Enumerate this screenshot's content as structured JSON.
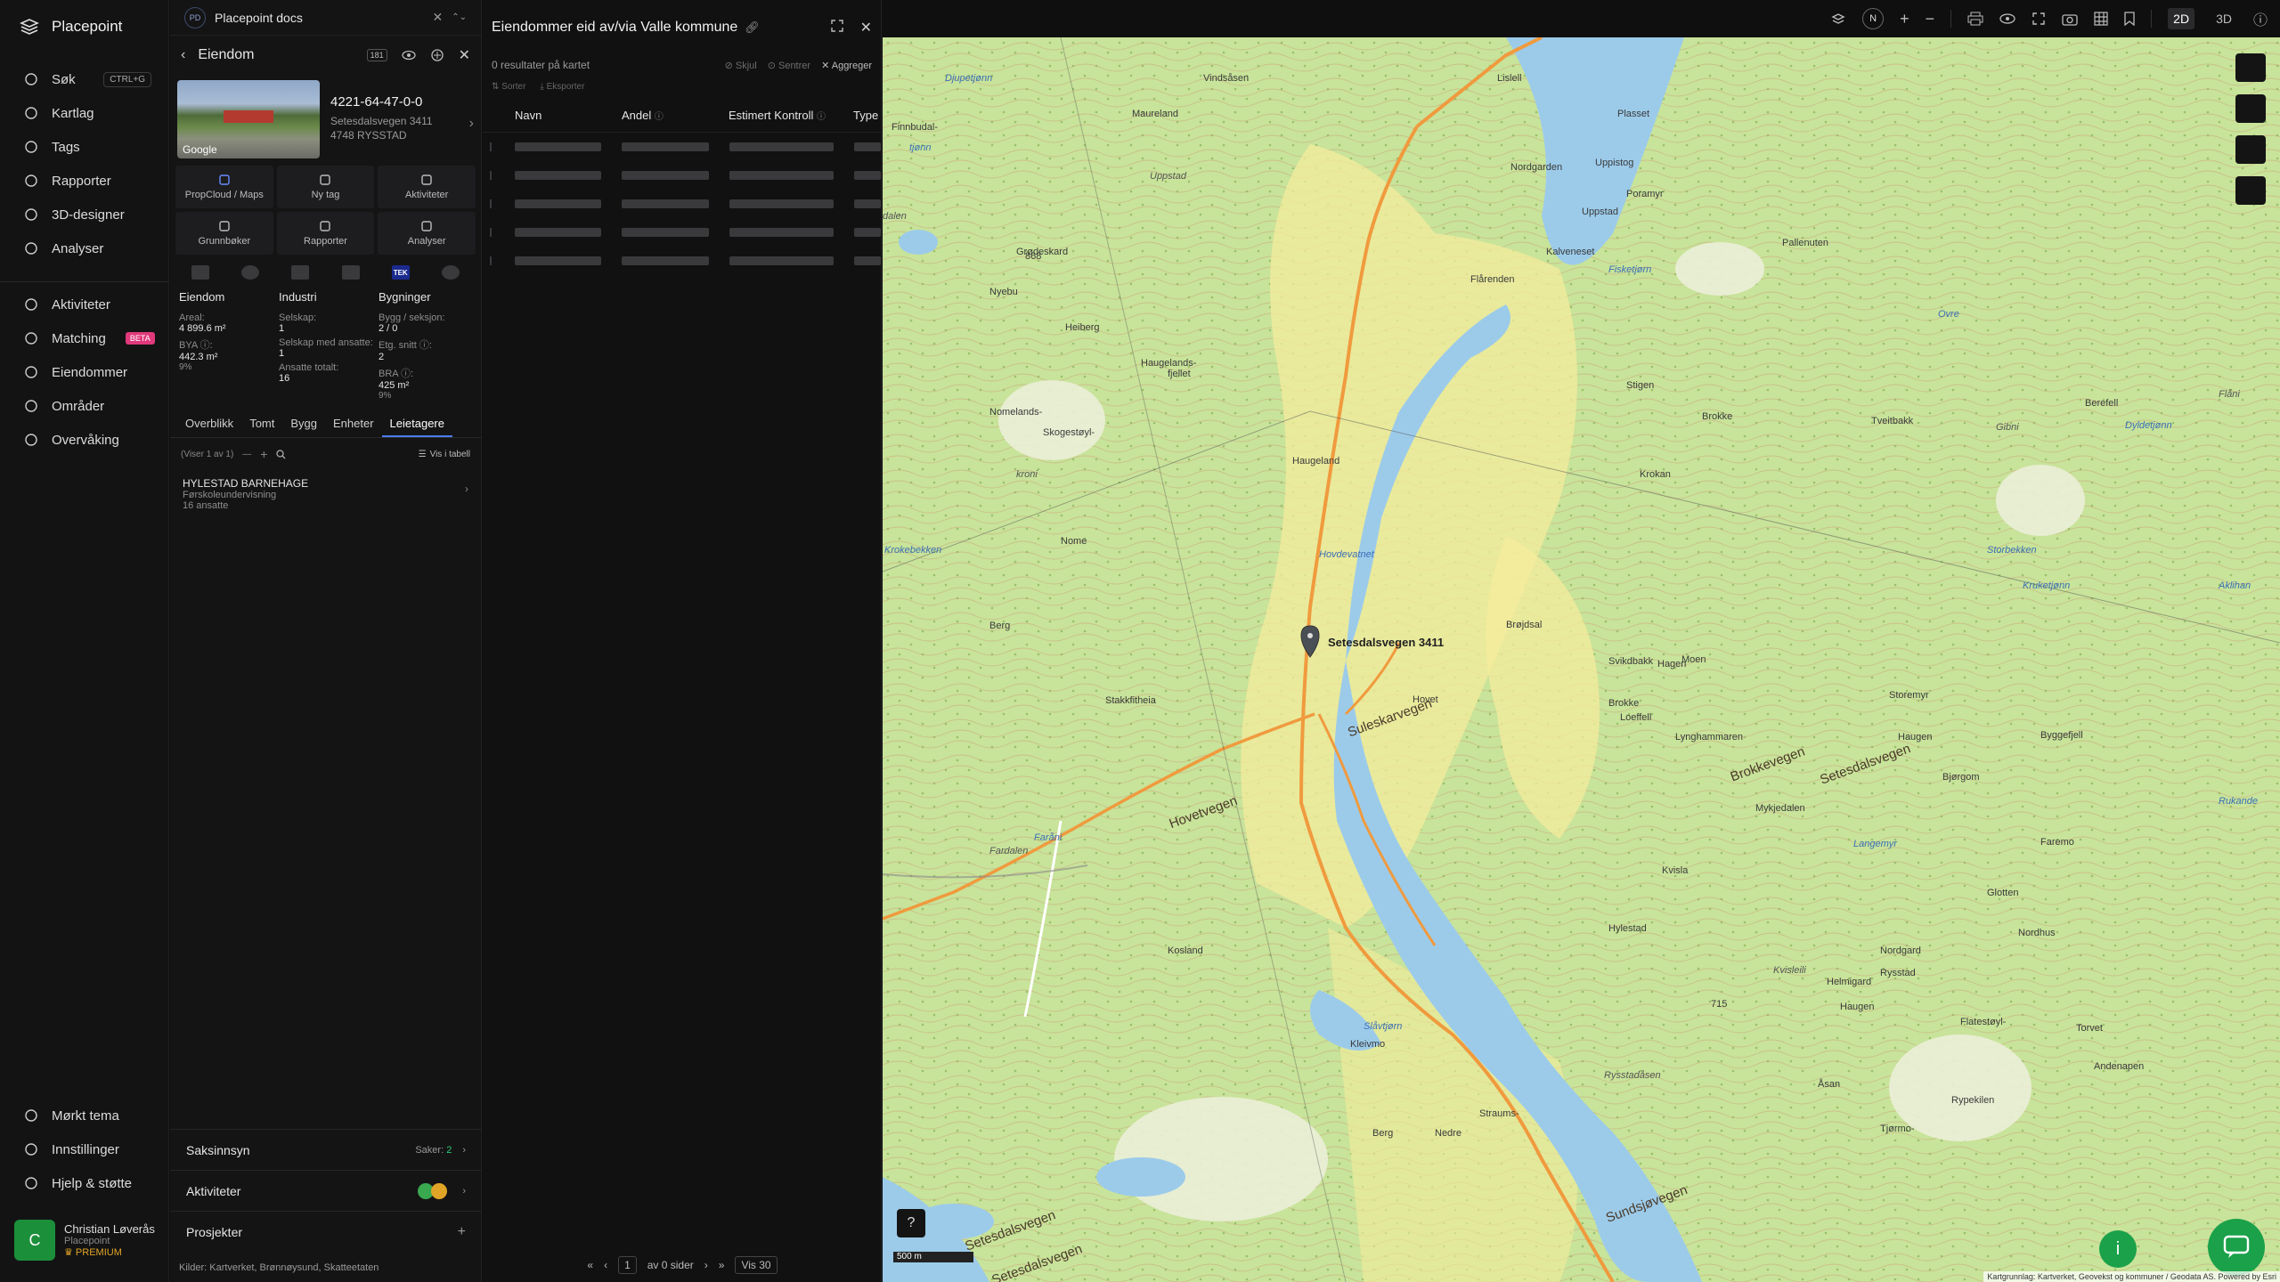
{
  "nav": {
    "brand": "Placepoint",
    "items": [
      {
        "icon": "search-icon",
        "label": "Søk",
        "kbd": "CTRL+G"
      },
      {
        "icon": "layers-icon",
        "label": "Kartlag"
      },
      {
        "icon": "bookmark-icon",
        "label": "Tags"
      },
      {
        "icon": "chart-icon",
        "label": "Rapporter"
      },
      {
        "icon": "cube-icon",
        "label": "3D-designer"
      },
      {
        "icon": "bolt-icon",
        "label": "Analyser"
      }
    ],
    "items2": [
      {
        "icon": "activity-icon",
        "label": "Aktiviteter"
      },
      {
        "icon": "matching-icon",
        "label": "Matching",
        "badge": "BETA"
      },
      {
        "icon": "building-icon",
        "label": "Eiendommer"
      },
      {
        "icon": "area-icon",
        "label": "Områder"
      },
      {
        "icon": "monitor-icon",
        "label": "Overvåking"
      }
    ],
    "bottom": [
      {
        "icon": "moon-icon",
        "label": "Mørkt tema"
      },
      {
        "icon": "gear-icon",
        "label": "Innstillinger"
      },
      {
        "icon": "help-icon",
        "label": "Hjelp & støtte"
      }
    ],
    "user": {
      "initial": "C",
      "name": "Christian Løverås",
      "org": "Placepoint",
      "plan": "PREMIUM"
    }
  },
  "prop": {
    "docs_badge": "PD",
    "docs_title": "Placepoint docs",
    "title": "Eiendom",
    "badge": "181",
    "photo_label": "Google",
    "id": "4221-64-47-0-0",
    "address1": "Setesdalsvegen 3411",
    "address2": "4748 RYSSTAD",
    "actions": [
      {
        "label": "PropCloud / Maps"
      },
      {
        "label": "Ny tag"
      },
      {
        "label": "Aktiviteter"
      },
      {
        "label": "Grunnbøker"
      },
      {
        "label": "Rapporter"
      },
      {
        "label": "Analyser"
      }
    ],
    "tek": "TEK",
    "stats": {
      "c1": {
        "h": "Eiendom",
        "l1": "Areal:",
        "v1": "4 899.6 m²",
        "l2": "BYA ⓘ:",
        "v2": "442.3 m²",
        "p2": "9%"
      },
      "c2": {
        "h": "Industri",
        "l1": "Selskap:",
        "v1": "1",
        "l2": "Selskap med ansatte:",
        "v2": "1",
        "l3": "Ansatte totalt:",
        "v3": "16"
      },
      "c3": {
        "h": "Bygninger",
        "l1": "Bygg / seksjon:",
        "v1": "2 / 0",
        "l2": "Etg. snitt ⓘ:",
        "v2": "2",
        "l3": "BRA ⓘ:",
        "v3": "425 m²",
        "p3": "9%"
      }
    },
    "tabs": [
      "Overblikk",
      "Tomt",
      "Bygg",
      "Enheter",
      "Leietagere"
    ],
    "viser": "(Viser 1 av 1)",
    "vis_i_tabell": "Vis i tabell",
    "tenant": {
      "name": "HYLESTAD BARNEHAGE",
      "type": "Førskoleundervisning",
      "count": "16 ansatte"
    },
    "saksinnsyn": "Saksinnsyn",
    "saker_label": "Saker:",
    "saker_count": "2",
    "aktiviteter": "Aktiviteter",
    "prosjekter": "Prosjekter",
    "kilder": "Kilder:",
    "kilder_list": [
      "Kartverket,",
      "Brønnøysund,",
      "Skatteetaten"
    ]
  },
  "results": {
    "title": "Eiendommer eid av/via Valle kommune",
    "count": "0 resultater på kartet",
    "skjul": "Skjul",
    "sentrer": "Sentrer",
    "aggreger": "Aggreger",
    "sorter": "Sorter",
    "eksporter": "Eksporter",
    "columns": [
      "Navn",
      "Andel",
      "Estimert Kontroll",
      "Type"
    ],
    "page": "1",
    "of_pages": "av 0 sider",
    "per_page": "Vis 30"
  },
  "topbar": {
    "north": "N",
    "mode2d": "2D",
    "mode3d": "3D"
  },
  "map": {
    "pin_label": "Setesdalsvegen 3411",
    "scale": "500 m",
    "attribution": "Kartgrunnlag: Kartverket, Geovekst og kommuner / Geodata AS. Powered by Esri",
    "labels": [
      {
        "t": "Djupetjønn",
        "w": 1
      },
      {
        "t": "Vindsåsen"
      },
      {
        "t": "Lislell"
      },
      {
        "t": "Plasset"
      },
      {
        "t": "Maureland"
      },
      {
        "t": "Finnbudal-"
      },
      {
        "t": "tjønn",
        "w": 1
      },
      {
        "t": "Uppstad",
        "i": 1
      },
      {
        "t": "Uppistog"
      },
      {
        "t": "Poramyr"
      },
      {
        "t": "Uppstad"
      },
      {
        "t": "Nordgarden"
      },
      {
        "t": "Pallenuten"
      },
      {
        "t": "dalen",
        "i": 1
      },
      {
        "t": "868"
      },
      {
        "t": "Grødeskard"
      },
      {
        "t": "Kalveneset"
      },
      {
        "t": "Flårenden"
      },
      {
        "t": "Fisketjørn",
        "w": 1
      },
      {
        "t": "Nyebu"
      },
      {
        "t": "Heiberg"
      },
      {
        "t": "Ovre",
        "w": 1
      },
      {
        "t": "Haugelands-"
      },
      {
        "t": "fjellet"
      },
      {
        "t": "Stigen"
      },
      {
        "t": "Flåni",
        "i": 1
      },
      {
        "t": "Berefell"
      },
      {
        "t": "Brokke"
      },
      {
        "t": "Tveitbakk"
      },
      {
        "t": "Nomelands-"
      },
      {
        "t": "Skogestøyl-"
      },
      {
        "t": "Dyldetjønn",
        "w": 1
      },
      {
        "t": "kroni",
        "i": 1
      },
      {
        "t": "Gibni",
        "i": 1
      },
      {
        "t": "Haugeland"
      },
      {
        "t": "Krokan"
      },
      {
        "t": "Krokebekken",
        "w": 1
      },
      {
        "t": "Hovdevatnet",
        "w": 1
      },
      {
        "t": "Storbekken",
        "w": 1
      },
      {
        "t": "Nome"
      },
      {
        "t": "Kruketjønn",
        "w": 1
      },
      {
        "t": "Aklihan",
        "w": 1
      },
      {
        "t": "Berg"
      },
      {
        "t": "Brøjdsal"
      },
      {
        "t": "Svikdbakk"
      },
      {
        "t": "Moen"
      },
      {
        "t": "Hagen"
      },
      {
        "t": "Loeffell"
      },
      {
        "t": "Brokke"
      },
      {
        "t": "Stakkfitheia"
      },
      {
        "t": "Hovet"
      },
      {
        "t": "Lynghammaren"
      },
      {
        "t": "Storemyr"
      },
      {
        "t": "Haugen"
      },
      {
        "t": "Byggefjell"
      },
      {
        "t": "Brokkevegen",
        "r": 1
      },
      {
        "t": "Suleskarvegen",
        "r": 1
      },
      {
        "t": "Setesdalsvegen",
        "r": 1
      },
      {
        "t": "Hovetvegen",
        "r": 1
      },
      {
        "t": "Mykjedalen"
      },
      {
        "t": "Rukande",
        "w": 1
      },
      {
        "t": "Fardalen",
        "i": 1
      },
      {
        "t": "Faråni",
        "w": 1
      },
      {
        "t": "Bjørgom"
      },
      {
        "t": "Langemyr",
        "w": 1
      },
      {
        "t": "Faremo"
      },
      {
        "t": "Kvisla"
      },
      {
        "t": "Glotten"
      },
      {
        "t": "Nordhus"
      },
      {
        "t": "Kosland"
      },
      {
        "t": "Nordgard"
      },
      {
        "t": "Helmigard"
      },
      {
        "t": "Hylestad"
      },
      {
        "t": "Flatestøyl-"
      },
      {
        "t": "Kvisleili",
        "i": 1
      },
      {
        "t": "Haugen"
      },
      {
        "t": "Rysstad"
      },
      {
        "t": "715"
      },
      {
        "t": "Slåvtjørn",
        "w": 1
      },
      {
        "t": "Torvet"
      },
      {
        "t": "Andenapen"
      },
      {
        "t": "Kleivmo"
      },
      {
        "t": "Nedre"
      },
      {
        "t": "Rysstadåsen",
        "i": 1
      },
      {
        "t": "Åsan"
      },
      {
        "t": "Tjørmo-"
      },
      {
        "t": "Rypekilen"
      },
      {
        "t": "Straums-"
      },
      {
        "t": "Berg"
      },
      {
        "t": "Setesdalsvegen",
        "r": 1
      },
      {
        "t": "Setesdalsvegen",
        "r": 1
      },
      {
        "t": "Sundsjøvegen",
        "r": 1
      }
    ]
  }
}
